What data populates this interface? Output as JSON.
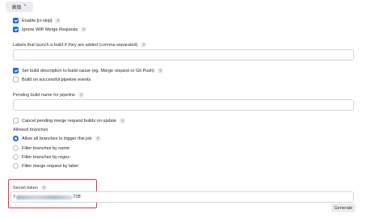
{
  "toolbar": {
    "collapse_label": "高级",
    "collapse_icon": "chevron-up-icon"
  },
  "options": {
    "enable_ci_skip": {
      "label": "Enable [ci-skip]",
      "checked": true
    },
    "ignore_wip": {
      "label": "Ignore WIP Merge Requests",
      "checked": true
    }
  },
  "labels_field": {
    "label": "Labels that launch a build if they are added (comma-separated)",
    "value": ""
  },
  "set_description": {
    "label": "Set build description to build cause (eg. Merge request or Git Push)",
    "checked": true
  },
  "build_on_success": {
    "label": "Build on successful pipeline events",
    "checked": false
  },
  "pending_name": {
    "label": "Pending build name for pipeline",
    "value": ""
  },
  "cancel_pending": {
    "label": "Cancel pending merge request builds on update",
    "checked": false
  },
  "allowed_branches": {
    "heading": "Allowed branches",
    "options": [
      {
        "label": "Allow all branches to trigger this job",
        "selected": true
      },
      {
        "label": "Filter branches by name",
        "selected": false
      },
      {
        "label": "Filter branches by regex",
        "selected": false
      },
      {
        "label": "Filter merge request by label",
        "selected": false
      }
    ]
  },
  "secret_token": {
    "label": "Secret token",
    "prefix": "f",
    "suffix": "728",
    "generate_label": "Generate"
  },
  "help_glyph": "?"
}
